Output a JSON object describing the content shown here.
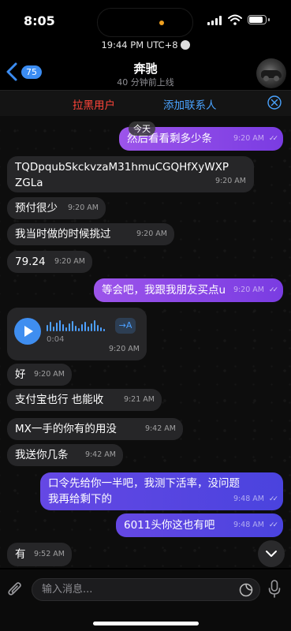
{
  "status_bar": {
    "time": "8:05",
    "sub_status": "19:44 PM UTC+8"
  },
  "header": {
    "back_count": "75",
    "title": "奔驰",
    "subtitle": "40 分钟前上线"
  },
  "action_bar": {
    "block": "拉黑用户",
    "add_contact": "添加联系人"
  },
  "day_label": "今天",
  "messages": [
    {
      "dir": "out",
      "text": "然后看看剩多少条",
      "time": "9:20 AM"
    },
    {
      "dir": "in",
      "text": "TQDpqubSkckvzaM31hmuCGQHfXyWXP",
      "text2": "ZGLa",
      "time": "9:20 AM"
    },
    {
      "dir": "in",
      "text": "预付很少",
      "time": "9:20 AM"
    },
    {
      "dir": "in",
      "text": "我当时做的时候挑过",
      "time": "9:20 AM"
    },
    {
      "dir": "in",
      "text": "79.24",
      "time": "9:20 AM"
    },
    {
      "dir": "out",
      "text": "等会吧，我跟我朋友买点u",
      "time": "9:20 AM"
    },
    {
      "dir": "in",
      "type": "voice",
      "duration": "0:04",
      "transcribe": "→A",
      "time": "9:20 AM"
    },
    {
      "dir": "in",
      "text": "好",
      "time": "9:20 AM"
    },
    {
      "dir": "in",
      "text": "支付宝也行 也能收",
      "time": "9:21 AM"
    },
    {
      "dir": "in",
      "text": "MX一手的你有的用没",
      "time": "9:42 AM"
    },
    {
      "dir": "in",
      "text": "我送你几条",
      "time": "9:42 AM"
    },
    {
      "dir": "out",
      "text": "口令先给你一半吧，我测下活率，没问题",
      "text2": "我再给剩下的",
      "time": "9:48 AM"
    },
    {
      "dir": "out",
      "text": "6011头你这也有吧",
      "time": "9:48 AM"
    },
    {
      "dir": "in",
      "text": "有",
      "time": "9:52 AM"
    }
  ],
  "input": {
    "placeholder": "输入消息..."
  },
  "colors": {
    "accent": "#3b8cf2",
    "danger": "#ff453a",
    "outgoing_purple": "#8b47e6",
    "outgoing_blue": "#5746e2",
    "incoming": "#262628"
  },
  "icons": [
    "back-chevron-icon",
    "close-circle-icon",
    "play-icon",
    "chevron-down-icon",
    "paperclip-icon",
    "sticker-icon",
    "microphone-icon"
  ]
}
